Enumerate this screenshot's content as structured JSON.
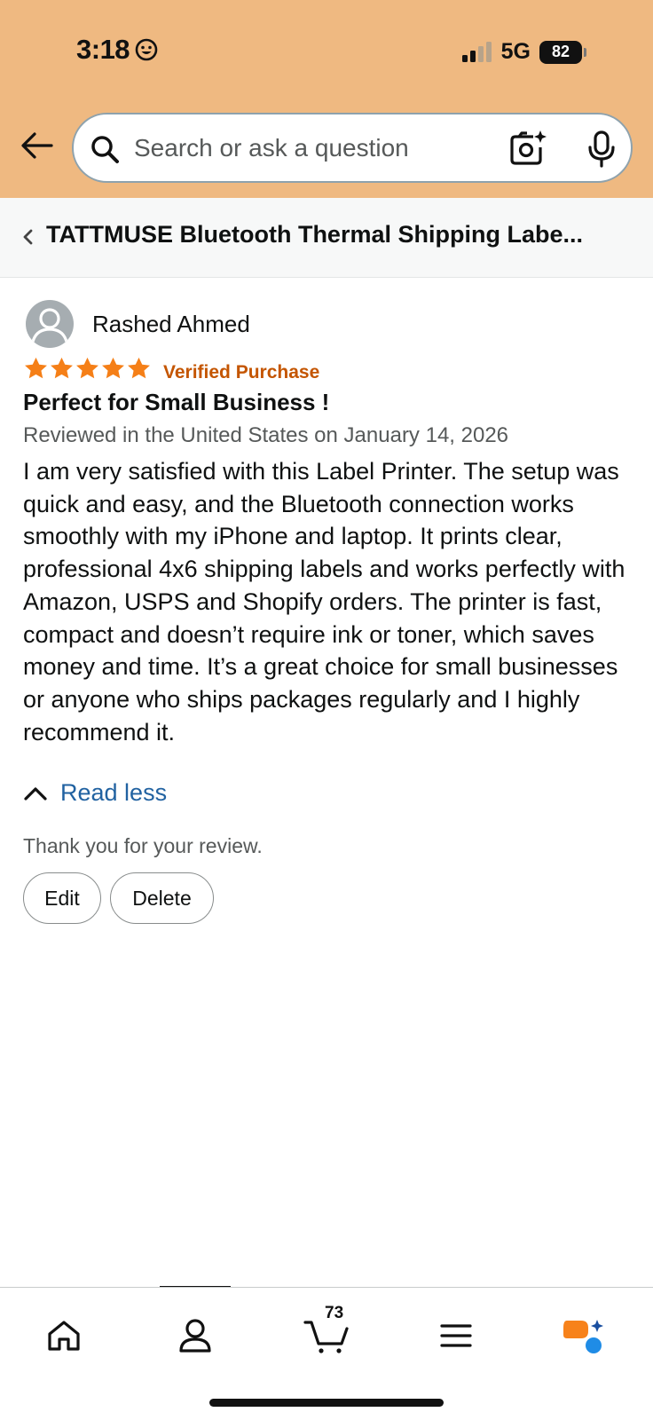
{
  "status_bar": {
    "time": "3:18",
    "network": "5G",
    "battery": "82"
  },
  "search": {
    "placeholder": "Search or ask a question"
  },
  "breadcrumb": {
    "title": "TATTMUSE Bluetooth Thermal Shipping Labe..."
  },
  "review": {
    "reviewer": "Rashed Ahmed",
    "rating": 5,
    "rating_max": 5,
    "verified": "Verified Purchase",
    "title": "Perfect for Small Business !",
    "date": "Reviewed in the United States on January 14, 2026",
    "body": "I am very satisfied with this Label Printer. The setup was quick and easy, and the Bluetooth connection works smoothly with my iPhone and laptop. It prints clear, professional 4x6 shipping labels and works perfectly with Amazon, USPS and Shopify orders. The printer is fast, compact and doesn’t require ink or toner, which saves money and time. It’s a great choice for small businesses or anyone who ships packages regularly and I highly recommend it.",
    "read_less": "Read less",
    "thanks": "Thank you for your review.",
    "edit_label": "Edit",
    "delete_label": "Delete"
  },
  "tabbar": {
    "cart_count": "73",
    "tabs": [
      "home-icon",
      "account-icon",
      "cart-icon",
      "menu-icon",
      "rufus-icon"
    ]
  },
  "colors": {
    "header_bg": "#efb981",
    "star": "#f57f17",
    "verified": "#c45500",
    "link": "#2162a1"
  }
}
